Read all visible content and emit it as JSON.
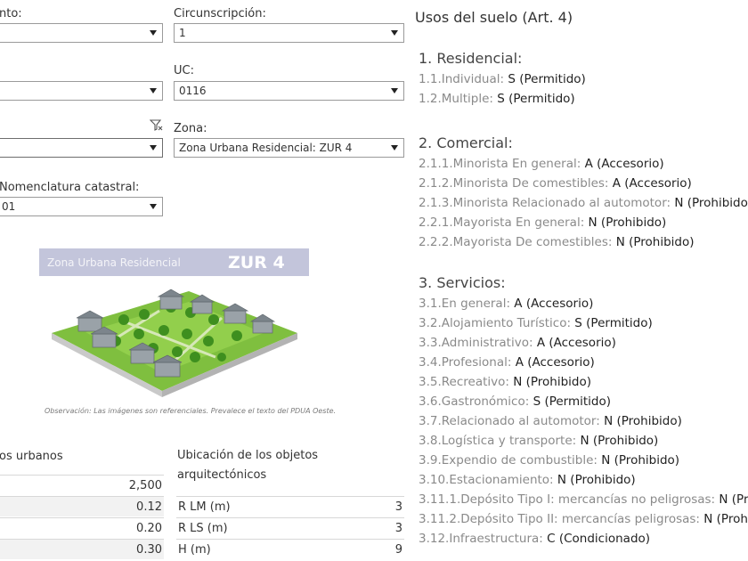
{
  "filters": {
    "f_top_left": {
      "label": "nto:",
      "value": ""
    },
    "circunscripcion": {
      "label": "Circunscripción:",
      "value": "1"
    },
    "f_mid_left": {
      "label": "",
      "value": ""
    },
    "uc": {
      "label": "UC:",
      "value": "0116"
    },
    "f_low_left": {
      "label": "",
      "value": ""
    },
    "zona": {
      "label": "Zona:",
      "value": "Zona Urbana Residencial: ZUR 4"
    },
    "nomenclatura": {
      "label": "Nomenclatura catastral:",
      "value": "01"
    }
  },
  "zone_image": {
    "band_text": "Zona Urbana Residencial",
    "band_code": "ZUR 4",
    "note": "Observación: Las imágenes son referenciales. Prevalece el texto del PDUA Oeste."
  },
  "indicadores": {
    "title": "os urbanos",
    "rows": [
      {
        "value": "2,500"
      },
      {
        "value": "0.12"
      },
      {
        "value": "0.20"
      },
      {
        "value": "0.30"
      }
    ]
  },
  "ubicacion": {
    "title_line1": "Ubicación de los objetos",
    "title_line2": "arquitectónicos",
    "rows": [
      {
        "label": "R LM  (m)",
        "value": "3"
      },
      {
        "label": "R LS  (m)",
        "value": "3"
      },
      {
        "label": "H (m)",
        "value": "9"
      }
    ]
  },
  "usos": {
    "title": "Usos del suelo (Art. 4)",
    "categories": [
      {
        "head": "1. Residencial:",
        "items": [
          {
            "code": "1.1.Individual: ",
            "val": "S (Permitido)"
          },
          {
            "code": "1.2.Multiple: ",
            "val": "S (Permitido)"
          }
        ]
      },
      {
        "head": "2. Comercial:",
        "items": [
          {
            "code": "2.1.1.Minorista En general: ",
            "val": "A (Accesorio)"
          },
          {
            "code": "2.1.2.Minorista De comestibles: ",
            "val": "A (Accesorio)"
          },
          {
            "code": "2.1.3.Minorista Relacionado al automotor: ",
            "val": "N (Prohibido)"
          },
          {
            "code": "2.2.1.Mayorista En general: ",
            "val": "N (Prohibido)"
          },
          {
            "code": "2.2.2.Mayorista De comestibles: ",
            "val": "N (Prohibido)"
          }
        ]
      },
      {
        "head": "3. Servicios:",
        "items": [
          {
            "code": "3.1.En general: ",
            "val": "A (Accesorio)"
          },
          {
            "code": "3.2.Alojamiento Turístico: ",
            "val": "S (Permitido)"
          },
          {
            "code": "3.3.Administrativo: ",
            "val": "A (Accesorio)"
          },
          {
            "code": "3.4.Profesional: ",
            "val": "A (Accesorio)"
          },
          {
            "code": "3.5.Recreativo: ",
            "val": "N (Prohibido)"
          },
          {
            "code": "3.6.Gastronómico: ",
            "val": "S (Permitido)"
          },
          {
            "code": "3.7.Relacionado al automotor: ",
            "val": "N (Prohibido)"
          },
          {
            "code": "3.8.Logística y transporte: ",
            "val": "N (Prohibido)"
          },
          {
            "code": "3.9.Expendio de combustible: ",
            "val": "N (Prohibido)"
          },
          {
            "code": "3.10.Estacionamiento: ",
            "val": "N (Prohibido)"
          },
          {
            "code": "3.11.1.Depósito Tipo I: mercancías no peligrosas: ",
            "val": "N (Prohibido)"
          },
          {
            "code": "3.11.2.Depósito Tipo II: mercancías peligrosas: ",
            "val": "N (Prohibido)"
          },
          {
            "code": "3.12.Infraestructura: ",
            "val": "C (Condicionado)"
          }
        ]
      }
    ]
  }
}
